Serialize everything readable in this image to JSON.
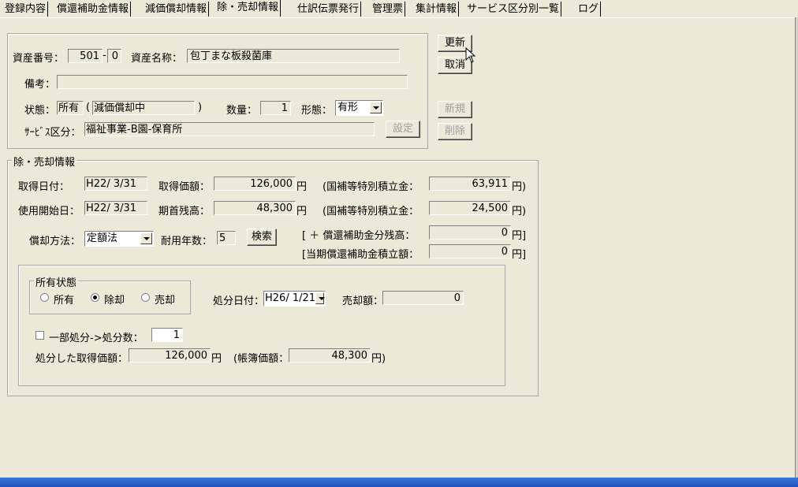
{
  "tabs": [
    "登録内容",
    "償還補助金情報",
    "減価償却情報",
    "除・売却情報",
    "仕訳伝票発行",
    "管理票",
    "集計情報",
    "サービス区分別一覧",
    "ログ"
  ],
  "asset": {
    "number_label": "資産番号：",
    "number_main": "501",
    "number_sep": "-",
    "number_sub": "0",
    "name_label": "資産名称：",
    "name_value": "包丁まな板殺菌庫",
    "remarks_label": "備考：",
    "remarks_value": "",
    "status_label": "状態：",
    "status_value": "所有",
    "status_open": "(",
    "status_detail": "減価償却中",
    "status_close": ")",
    "quantity_label": "数量：",
    "quantity_value": "1",
    "form_label": "形態：",
    "form_value": "有形",
    "service_label": "ｻｰﾋﾞｽ区分：",
    "service_value": "福祉事業-B園-保育所",
    "setting_button": "設定"
  },
  "actions": {
    "update": "更新",
    "cancel": "取消",
    "new": "新規",
    "delete": "削除"
  },
  "disposal": {
    "group_title": "除・売却情報",
    "acq_date_label": "取得日付：",
    "acq_date_value": "H22/ 3/31",
    "acq_price_label": "取得価額：",
    "acq_price_value": "126,000",
    "yen": "円",
    "subsidy1_label": "(国補等特別積立金：",
    "subsidy1_value": "63,911",
    "subsidy1_suffix": "円)",
    "start_date_label": "使用開始日：",
    "start_date_value": "H22/ 3/31",
    "opening_balance_label": "期首残高：",
    "opening_balance_value": "48,300",
    "subsidy2_label": "(国補等特別積立金：",
    "subsidy2_value": "24,500",
    "subsidy2_suffix": "円)",
    "method_label": "償却方法：",
    "method_value": "定額法",
    "life_label": "耐用年数：",
    "life_value": "5",
    "search_button": "検索",
    "repay_label": "[ ＋ 償還補助金分残高：",
    "repay_value": "0",
    "repay_suffix": "円]",
    "current_label": "[当期償還補助金積立額：",
    "current_value": "0",
    "current_suffix": "円]"
  },
  "ownership": {
    "group_title": "所有状態",
    "options": [
      "所有",
      "除却",
      "売却"
    ],
    "selected": "除却",
    "disposal_date_label": "処分日付：",
    "disposal_date_value": "H26/ 1/21",
    "sale_amount_label": "売却額：",
    "sale_amount_value": "0",
    "partial_label": "一部処分->処分数：",
    "partial_checked": false,
    "partial_value": "1",
    "disposed_acq_label": "処分した取得価額：",
    "disposed_acq_value": "126,000",
    "disposed_acq_suffix": "円",
    "book_value_label": "(帳簿価額：",
    "book_value_value": "48,300",
    "book_value_suffix": "円)"
  }
}
